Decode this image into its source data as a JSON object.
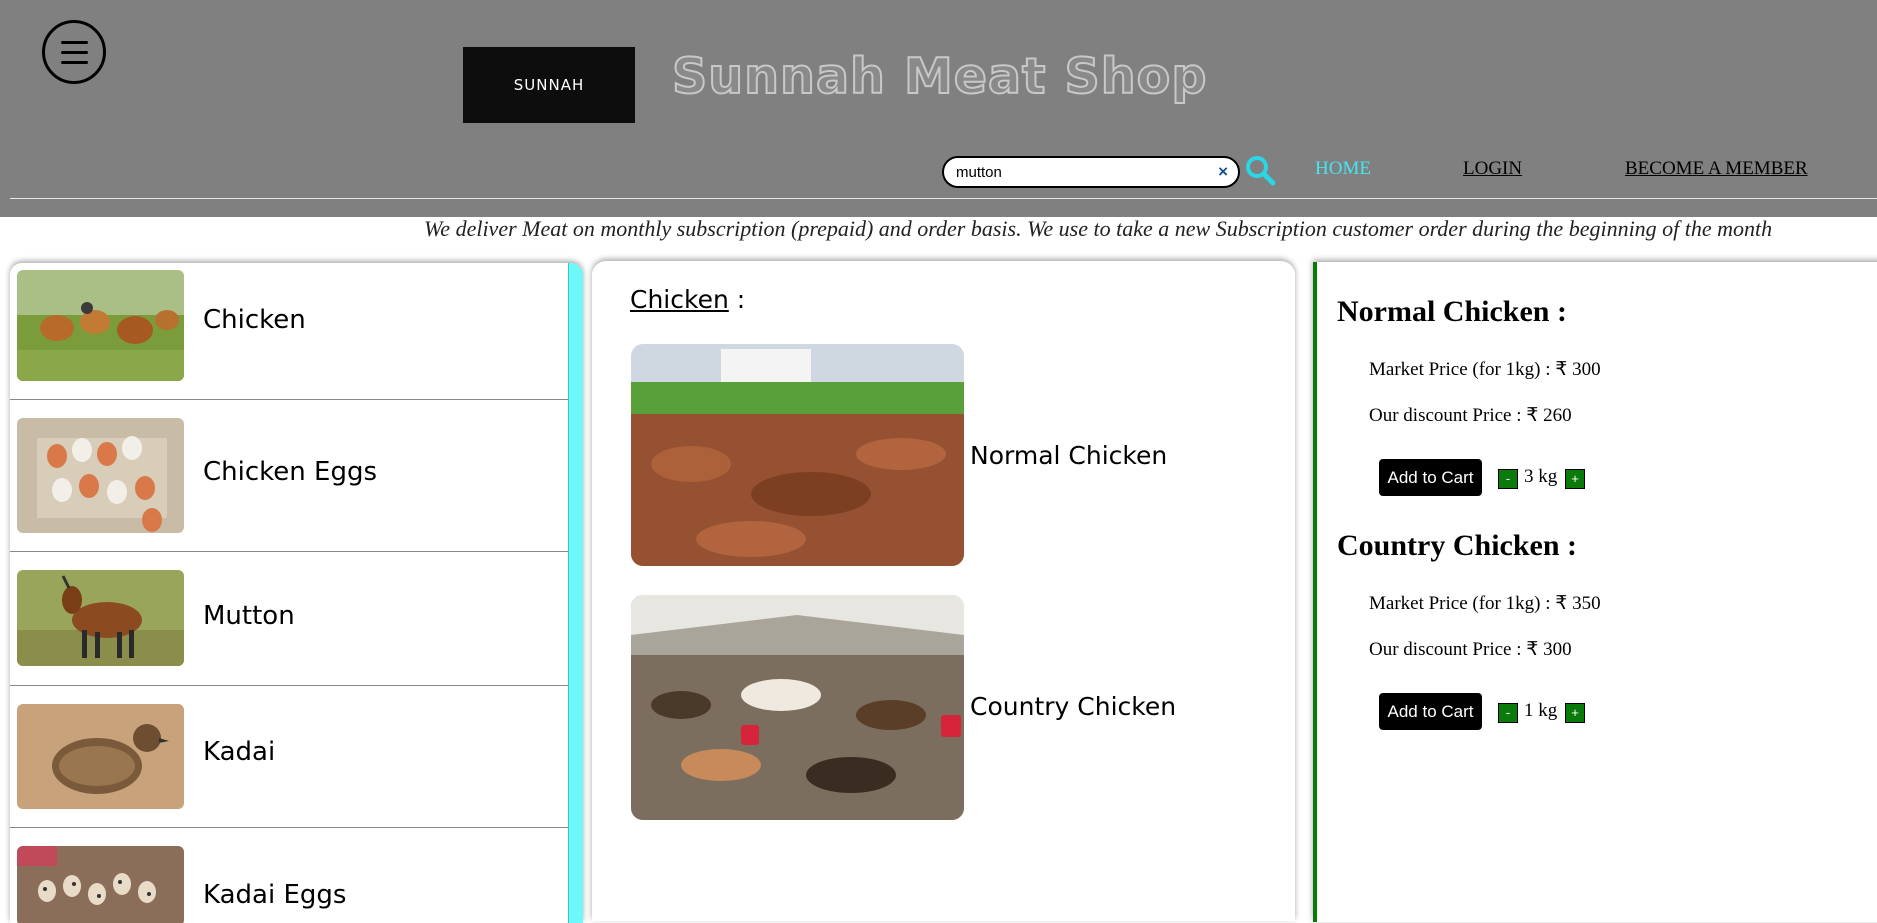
{
  "header": {
    "menu_icon": "hamburger-menu-icon",
    "logo_text": "SUNNAH",
    "title": "Sunnah Meat Shop",
    "search": {
      "value": "mutton",
      "placeholder": "",
      "clear_label": "×"
    },
    "search_icon": "magnifier-icon",
    "nav": {
      "home": "HOME",
      "login": "LOGIN",
      "member": "BECOME A MEMBER"
    },
    "colors": {
      "header_bg": "#808080",
      "active_nav": "#44e6f0"
    }
  },
  "marquee": {
    "text": "We deliver Meat on monthly subscription (prepaid) and order basis. We use to take a new Subscription customer order during the beginning of the month"
  },
  "categories": [
    {
      "label": "Chicken",
      "image": "chickens-in-field"
    },
    {
      "label": "Chicken Eggs",
      "image": "eggs-in-carton"
    },
    {
      "label": "Mutton",
      "image": "goat"
    },
    {
      "label": "Kadai",
      "image": "quail-bird"
    },
    {
      "label": "Kadai Eggs",
      "image": "quail-eggs"
    }
  ],
  "middle": {
    "heading": "Chicken",
    "heading_suffix": " :",
    "products": [
      {
        "label": "Normal Chicken",
        "image": "poultry-farm-field"
      },
      {
        "label": "Country Chicken",
        "image": "poultry-shed"
      }
    ]
  },
  "details": [
    {
      "title": "Normal Chicken :",
      "market_price": "Market Price (for 1kg) : ₹ 300",
      "discount_price": "Our discount Price : ₹ 260",
      "add_label": "Add to Cart",
      "minus": "-",
      "plus": "+",
      "qty": "3 kg"
    },
    {
      "title": "Country Chicken :",
      "market_price": "Market Price (for 1kg) : ₹ 350",
      "discount_price": "Our discount Price : ₹ 300",
      "add_label": "Add to Cart",
      "minus": "-",
      "plus": "+",
      "qty": "1 kg"
    }
  ]
}
